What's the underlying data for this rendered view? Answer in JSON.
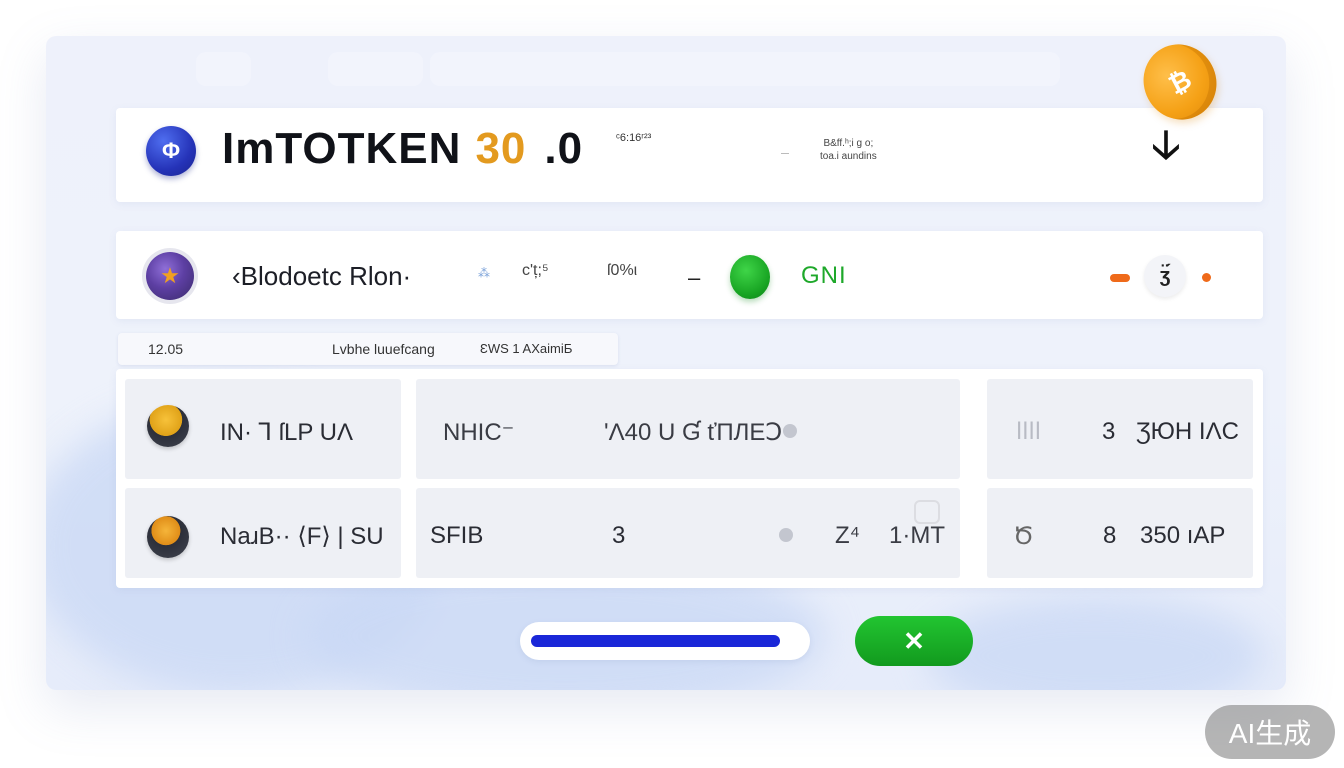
{
  "header": {
    "brand_main": "ImTOTKEN",
    "brand_version": "30",
    "brand_suffix": ".0",
    "brand_superscript": "ᶜ6:16ʳ²³",
    "mini_line1": "B&ff.ʰ;i g o;",
    "mini_line2": "toa.i aundins",
    "logo_glyph": "Φ",
    "download_icon": "arrow-down-icon",
    "download_glyph": "🡣"
  },
  "coin": {
    "icon": "coin-icon",
    "glyph": "₿"
  },
  "ticker": {
    "name": "‹Blodoetc Rlon·",
    "star": "⁂",
    "change": "c'ț;⁵",
    "percent": "ſ0%ι",
    "dash": "–",
    "status": "GNI",
    "status_color": "#1ea82a",
    "round_glyph": "ʒ̈́",
    "accent_color": "#ef6a1a"
  },
  "subbar": {
    "value": "12.05",
    "label": "Lvbhe luuefcang",
    "note": "ƐWS 1 AXaimiƂ"
  },
  "table": {
    "rows": [
      {
        "name": "IN·  ⅂ ſLP UΛ",
        "pair": "NHIC⁻",
        "detail": "ʹΛ40 U Ɠ ťΠЛEↃ",
        "bars": "ǀǀǀǀ",
        "qty": "3",
        "amount": "ƷЮH IΛC"
      },
      {
        "name": "NaɹB··   ⟨F⟩ | SU",
        "pair": "SFIB",
        "count": "3",
        "small1": "Z⁴",
        "small2": "1·MT",
        "mark": "Ծ",
        "qty": "8",
        "amount": "350 ıAP"
      }
    ]
  },
  "progress": {
    "value": 0.93,
    "color": "#1a27d8"
  },
  "close_button": {
    "label": "✕",
    "color": "#1aa928"
  },
  "watermark": "AI生成"
}
